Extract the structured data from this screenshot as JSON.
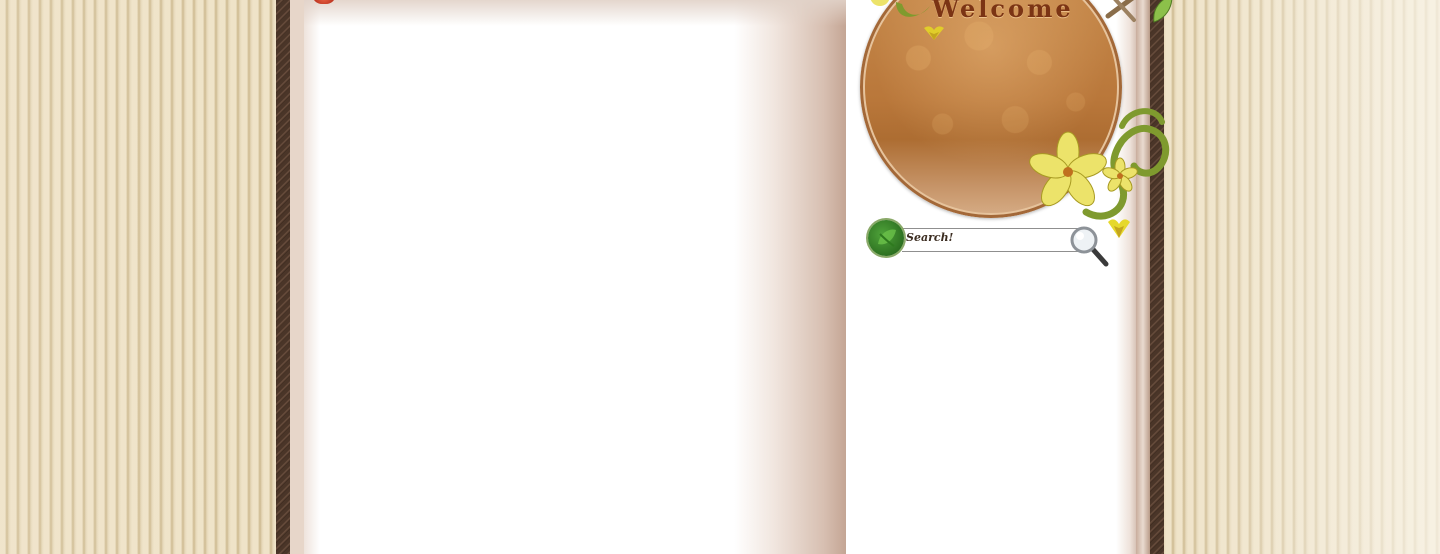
{
  "header": {
    "welcome_text": "Welcome"
  },
  "search": {
    "label": "Search!",
    "value": ""
  },
  "icons": {
    "search_button": "magnifier-icon",
    "leaf_badge": "leaf-icon",
    "flowers": "flower-icon"
  },
  "colors": {
    "frame": "#4a3528",
    "badge": "#b9773a",
    "welcome_text": "#7b3414",
    "flower": "#e8df5a"
  }
}
